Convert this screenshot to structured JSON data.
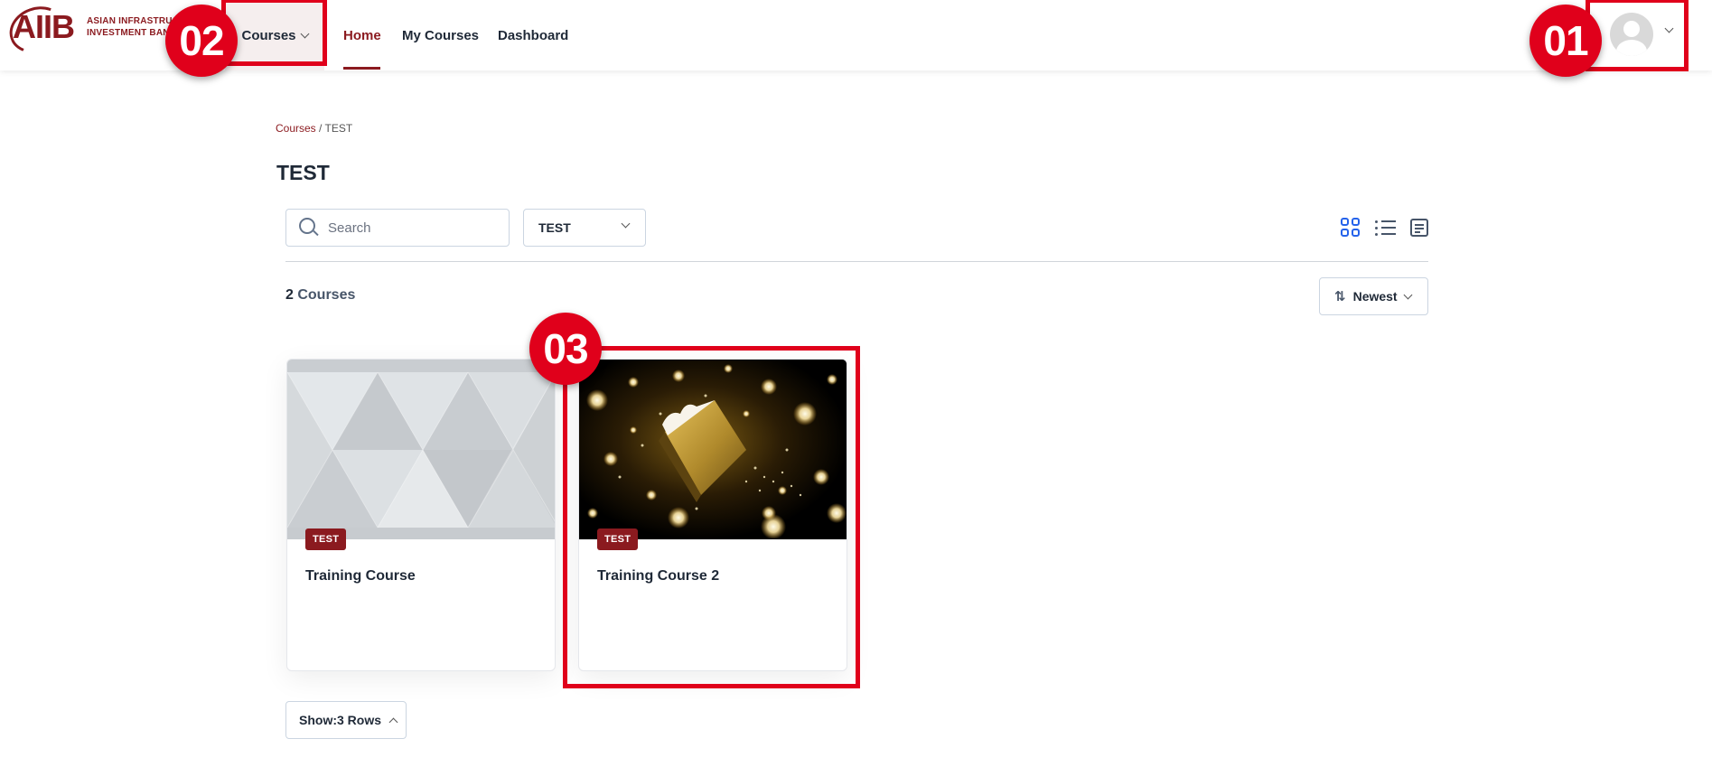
{
  "header": {
    "logo_mark": "AIIB",
    "logo_line1": "ASIAN INFRASTRUCTURE",
    "logo_line2": "INVESTMENT BANK",
    "nav": {
      "courses": "Courses",
      "home": "Home",
      "my_courses": "My Courses",
      "dashboard": "Dashboard"
    },
    "user_icon": "avatar-icon"
  },
  "annotations": {
    "badge_01": "01",
    "badge_02": "02",
    "badge_03": "03",
    "color": "#e0001b"
  },
  "breadcrumb": {
    "root": "Courses",
    "separator": " / ",
    "current": "TEST"
  },
  "page_title": "TEST",
  "filters": {
    "search_placeholder": "Search",
    "category_value": "TEST"
  },
  "view_modes": [
    "grid-view-icon",
    "list-view-icon",
    "summary-view-icon"
  ],
  "results": {
    "count": "2",
    "label": " Courses"
  },
  "sort": {
    "label": "Newest"
  },
  "courses": [
    {
      "badge": "TEST",
      "title": "Training Course",
      "thumbnail": "triangle-pattern"
    },
    {
      "badge": "TEST",
      "title": "Training Course 2",
      "thumbnail": "gold-particles"
    }
  ],
  "pagination": {
    "show_label": "Show:3 Rows"
  },
  "colors": {
    "brand": "#8b1a1f",
    "accent_blue": "#2563eb"
  }
}
